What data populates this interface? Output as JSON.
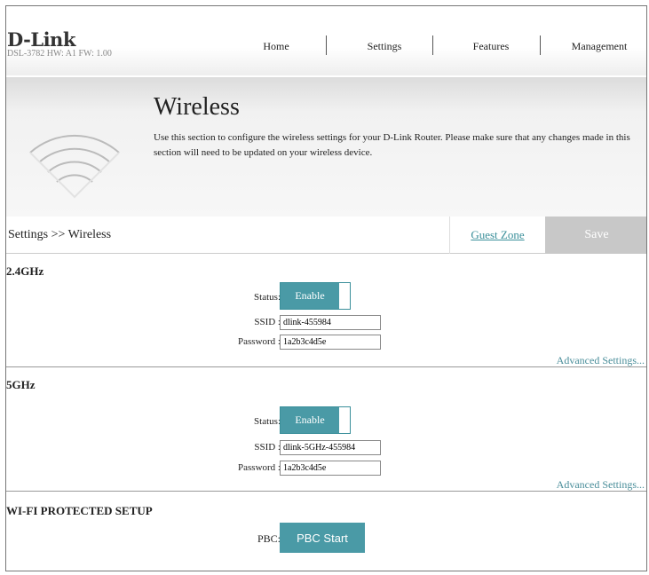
{
  "header": {
    "logo": "D-Link",
    "model": "DSL-3782  HW: A1  FW: 1.00",
    "nav": [
      "Home",
      "Settings",
      "Features",
      "Management"
    ]
  },
  "banner": {
    "title": "Wireless",
    "description": "Use this section to configure the wireless settings for your D-Link Router. Please make sure that any changes made in this section will need to be updated on your wireless device."
  },
  "crumb": {
    "text": "Settings >> Wireless",
    "guest_zone": "Guest Zone",
    "save": "Save"
  },
  "band24": {
    "heading": "2.4GHz",
    "status_label": "Status:",
    "status_value": "Enable",
    "ssid_label": "SSID :",
    "ssid": "dlink-455984",
    "password_label": "Password :",
    "password": "1a2b3c4d5e",
    "advanced": "Advanced Settings..."
  },
  "band5": {
    "heading": "5GHz",
    "status_label": "Status:",
    "status_value": "Enable",
    "ssid_label": "SSID :",
    "ssid": "dlink-5GHz-455984",
    "password_label": "Password :",
    "password": "1a2b3c4d5e",
    "advanced": "Advanced Settings..."
  },
  "wps": {
    "heading": "WI-FI PROTECTED SETUP",
    "pbc_label": "PBC:",
    "pbc_button": "PBC Start"
  }
}
